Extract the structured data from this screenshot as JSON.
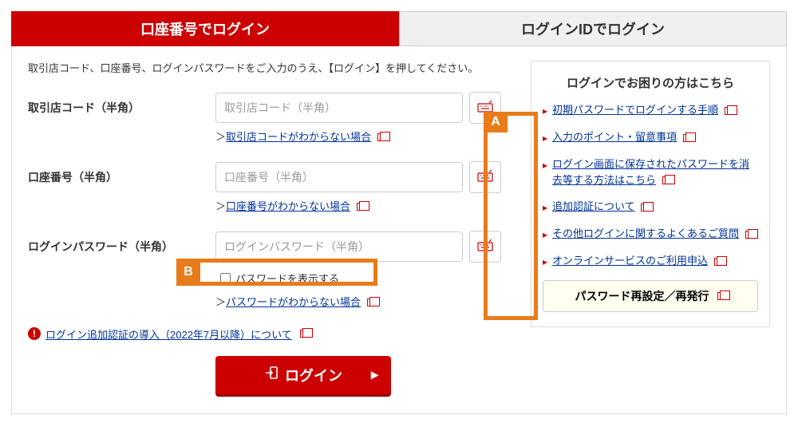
{
  "tabs": {
    "active": "口座番号でログイン",
    "inactive": "ログインIDでログイン"
  },
  "instructions": "取引店コード、口座番号、ログインパスワードをご入力のうえ、【ログイン】を押してください。",
  "fields": {
    "branch": {
      "label": "取引店コード（半角）",
      "placeholder": "取引店コード（半角）",
      "help": "取引店コードがわからない場合"
    },
    "account": {
      "label": "口座番号（半角）",
      "placeholder": "口座番号（半角）",
      "help": "口座番号がわからない場合"
    },
    "password": {
      "label": "ログインパスワード（半角）",
      "placeholder": "ログインパスワード（半角）",
      "help": "パスワードがわからない場合"
    }
  },
  "showPassword": "パスワードを表示する",
  "notice": "ログイン追加認証の導入（2022年7月以降）について",
  "loginBtn": "ログイン",
  "side": {
    "title": "ログインでお困りの方はこちら",
    "links": [
      "初期パスワードでログインする手順",
      "入力のポイント・留意事項",
      "ログイン画面に保存されたパスワードを消去等する方法はこちら",
      "追加認証について",
      "その他ログインに関するよくあるご質問",
      "オンラインサービスのご利用申込"
    ],
    "reset": "パスワード再設定／再発行"
  },
  "callouts": {
    "a": "A",
    "b": "B"
  }
}
